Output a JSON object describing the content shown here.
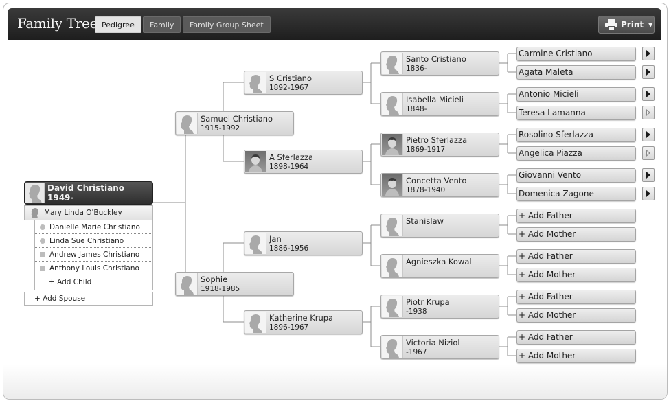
{
  "app": {
    "title": "Family Tree"
  },
  "tabs": [
    {
      "label": "Pedigree",
      "active": true
    },
    {
      "label": "Family",
      "active": false
    },
    {
      "label": "Family Group Sheet",
      "active": false
    }
  ],
  "toolbar": {
    "print_label": "Print",
    "print_icon": "printer-icon",
    "caret_icon": "caret-down-icon"
  },
  "root": {
    "name": "David Christiano",
    "dates": "1949-",
    "spouse": "Mary Linda O'Buckley",
    "children": [
      {
        "name": "Danielle Marie Christiano",
        "gender": "female"
      },
      {
        "name": "Linda Sue Christiano",
        "gender": "female"
      },
      {
        "name": "Andrew James Christiano",
        "gender": "male"
      },
      {
        "name": "Anthony Louis Christiano",
        "gender": "male"
      }
    ],
    "add_child_label": "+ Add Child",
    "add_spouse_label": "+ Add Spouse"
  },
  "generation1": [
    {
      "name": "Samuel Christiano",
      "dates": "1915-1992",
      "photo": false
    },
    {
      "name": "Sophie",
      "dates": "1918-1985",
      "photo": false
    }
  ],
  "generation2": [
    {
      "name": "S Cristiano",
      "dates": "1892-1967",
      "photo": false
    },
    {
      "name": "A Sferlazza",
      "dates": "1898-1964",
      "photo": true
    },
    {
      "name": "Jan",
      "dates": "1886-1956",
      "photo": false
    },
    {
      "name": "Katherine Krupa",
      "dates": "1896-1967",
      "photo": false
    }
  ],
  "generation3": [
    {
      "name": "Santo Cristiano",
      "dates": "1836-",
      "photo": false
    },
    {
      "name": "Isabella Micieli",
      "dates": "1848-",
      "photo": false
    },
    {
      "name": "Pietro Sferlazza",
      "dates": "1869-1917",
      "photo": true
    },
    {
      "name": "Concetta Vento",
      "dates": "1878-1940",
      "photo": true
    },
    {
      "name": "Stanislaw",
      "dates": "",
      "photo": false
    },
    {
      "name": "Agnieszka Kowal",
      "dates": "",
      "photo": false
    },
    {
      "name": "Piotr Krupa",
      "dates": "-1938",
      "photo": false
    },
    {
      "name": "Victoria Niziol",
      "dates": "-1967",
      "photo": false
    }
  ],
  "generation4": [
    {
      "name": "Carmine Cristiano",
      "more": "filled"
    },
    {
      "name": "Agata Maleta",
      "more": "filled"
    },
    {
      "name": "Antonio Micieli",
      "more": "filled"
    },
    {
      "name": "Teresa Lamanna",
      "more": "hollow"
    },
    {
      "name": "Rosolino Sferlazza",
      "more": "filled"
    },
    {
      "name": "Angelica Piazza",
      "more": "hollow"
    },
    {
      "name": "Giovanni Vento",
      "more": "filled"
    },
    {
      "name": "Domenica Zagone",
      "more": "filled"
    },
    {
      "name": "+ Add Father",
      "more": "none"
    },
    {
      "name": "+ Add Mother",
      "more": "none"
    },
    {
      "name": "+ Add Father",
      "more": "none"
    },
    {
      "name": "+ Add Mother",
      "more": "none"
    },
    {
      "name": "+ Add Father",
      "more": "none"
    },
    {
      "name": "+ Add Mother",
      "more": "none"
    },
    {
      "name": "+ Add Father",
      "more": "none"
    },
    {
      "name": "+ Add Mother",
      "more": "none"
    }
  ]
}
